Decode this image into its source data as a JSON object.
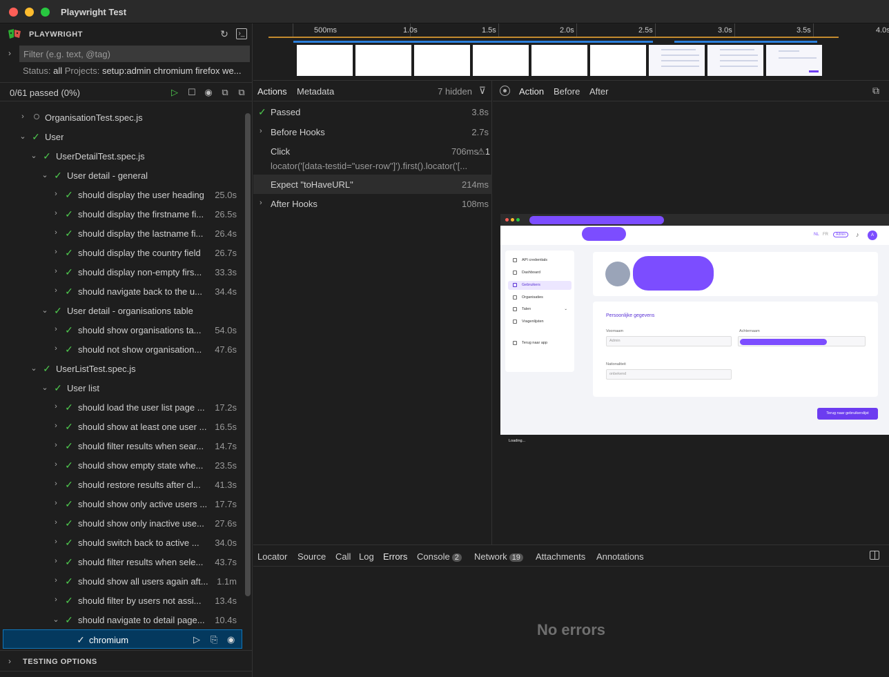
{
  "window": {
    "title": "Playwright Test"
  },
  "sidebar": {
    "brand": "PLAYWRIGHT",
    "filter_placeholder": "Filter (e.g. text, @tag)",
    "status_label": "Status:",
    "status_value": "all",
    "projects_label": "Projects:",
    "projects_value": "setup:admin chromium firefox we...",
    "passed_summary": "0/61 passed (0%)",
    "tree": [
      {
        "label": "OrganisationTest.spec.js",
        "duration": ""
      },
      {
        "label": "User",
        "duration": ""
      },
      {
        "label": "UserDetailTest.spec.js",
        "duration": ""
      },
      {
        "label": "User detail - general",
        "duration": ""
      },
      {
        "label": "should display the user heading",
        "duration": "25.0s"
      },
      {
        "label": "should display the firstname fi...",
        "duration": "26.5s"
      },
      {
        "label": "should display the lastname fi...",
        "duration": "26.4s"
      },
      {
        "label": "should display the country field",
        "duration": "26.7s"
      },
      {
        "label": "should display non-empty firs...",
        "duration": "33.3s"
      },
      {
        "label": "should navigate back to the u...",
        "duration": "34.4s"
      },
      {
        "label": "User detail - organisations table",
        "duration": ""
      },
      {
        "label": "should show organisations ta...",
        "duration": "54.0s"
      },
      {
        "label": "should not show organisation...",
        "duration": "47.6s"
      },
      {
        "label": "UserListTest.spec.js",
        "duration": ""
      },
      {
        "label": "User list",
        "duration": ""
      },
      {
        "label": "should load the user list page ...",
        "duration": "17.2s"
      },
      {
        "label": "should show at least one user ...",
        "duration": "16.5s"
      },
      {
        "label": "should filter results when sear...",
        "duration": "14.7s"
      },
      {
        "label": "should show empty state whe...",
        "duration": "23.5s"
      },
      {
        "label": "should restore results after cl...",
        "duration": "41.3s"
      },
      {
        "label": "should show only active users ...",
        "duration": "17.7s"
      },
      {
        "label": "should show only inactive use...",
        "duration": "27.6s"
      },
      {
        "label": "should switch back to active ...",
        "duration": "34.0s"
      },
      {
        "label": "should filter results when sele...",
        "duration": "43.7s"
      },
      {
        "label": "should show all users again aft...",
        "duration": "1.1m"
      },
      {
        "label": "should filter by users not assi...",
        "duration": "13.4s"
      },
      {
        "label": "should navigate to detail page...",
        "duration": "10.4s"
      },
      {
        "label": "chromium",
        "duration": ""
      }
    ],
    "testing_options": "TESTING OPTIONS"
  },
  "timeline": {
    "ticks": [
      "500ms",
      "1.0s",
      "1.5s",
      "2.0s",
      "2.5s",
      "3.0s",
      "3.5s",
      "4.0s"
    ]
  },
  "actions": {
    "tab_actions": "Actions",
    "tab_metadata": "Metadata",
    "hidden": "7 hidden",
    "items": [
      {
        "label": "Passed",
        "duration": "3.8s"
      },
      {
        "label": "Before Hooks",
        "duration": "2.7s"
      },
      {
        "label": "Click",
        "duration": "706ms"
      },
      {
        "label": "Expect \"toHaveURL\"",
        "duration": "214ms"
      },
      {
        "label": "After Hooks",
        "duration": "108ms"
      }
    ],
    "click_locator": "locator('[data-testid=\"user-row\"]').first().locator('[...",
    "warning_count": "1"
  },
  "snapshot": {
    "tab_action": "Action",
    "tab_before": "Before",
    "tab_after": "After",
    "page": {
      "lang_nl": "NL",
      "lang_fr": "FR",
      "admin_badge": "Admin",
      "avatar_letter": "A",
      "nav": [
        "API credentials",
        "Dashboard",
        "Gebruikers",
        "Organisaties",
        "Talen",
        "Vragenlijsten",
        "Terug naar app"
      ],
      "section_title": "Persoonlijke gegevens",
      "first_name_label": "Voornaam",
      "first_name_value": "Admin",
      "last_name_label": "Achternaam",
      "nationality_label": "Nationaliteit",
      "nationality_value": "onbekend",
      "back_button": "Terug naar gebruikerslijst",
      "status": "Loading..."
    }
  },
  "details": {
    "tabs": [
      "Locator",
      "Source",
      "Call",
      "Log",
      "Errors",
      "Console",
      "Network",
      "Attachments",
      "Annotations"
    ],
    "console_count": "2",
    "network_count": "19",
    "empty_message": "No errors"
  }
}
